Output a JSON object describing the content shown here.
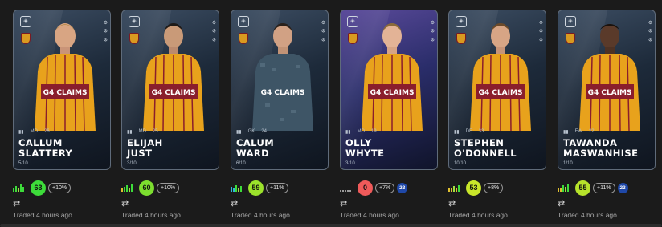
{
  "cards": [
    {
      "name_line1": "CALLUM",
      "name_line2": "SLATTERY",
      "serial": "5/10",
      "stats": [
        "MD",
        "26"
      ],
      "rating": "63",
      "rating_color": "#3ddc3a",
      "change": "+10%",
      "badge": "",
      "traded": "Traded 4 hours ago",
      "kit": "home"
    },
    {
      "name_line1": "ELIJAH",
      "name_line2": "JUST",
      "serial": "3/10",
      "stats": [
        "MD",
        "25"
      ],
      "rating": "60",
      "rating_color": "#7cde2f",
      "change": "+10%",
      "badge": "",
      "traded": "Traded 4 hours ago",
      "kit": "home"
    },
    {
      "name_line1": "CALUM",
      "name_line2": "WARD",
      "serial": "6/10",
      "stats": [
        "GK",
        "24"
      ],
      "rating": "59",
      "rating_color": "#9be22b",
      "change": "+11%",
      "badge": "",
      "traded": "Traded 4 hours ago",
      "kit": "keeper"
    },
    {
      "name_line1": "OLLY",
      "name_line2": "WHYTE",
      "serial": "3/10",
      "stats": [
        "MD",
        "19"
      ],
      "rating": "0",
      "rating_color": "#ef5a5a",
      "change": "+7%",
      "badge": "23",
      "traded": "Traded 4 hours ago",
      "kit": "home"
    },
    {
      "name_line1": "STEPHEN",
      "name_line2": "O'DONNELL",
      "serial": "10/10",
      "stats": [
        "DF",
        "33"
      ],
      "rating": "53",
      "rating_color": "#c9e62a",
      "change": "+8%",
      "badge": "",
      "traded": "Traded 4 hours ago",
      "kit": "home"
    },
    {
      "name_line1": "TAWANDA",
      "name_line2": "MASWANHISE",
      "serial": "1/10",
      "stats": [
        "FW",
        "22"
      ],
      "rating": "55",
      "rating_color": "#b6e32b",
      "change": "+11%",
      "badge": "23",
      "traded": "Traded 4 hours ago",
      "kit": "home"
    }
  ],
  "icons": {
    "league": "spfl-logo-icon",
    "crest": "club-crest-icon",
    "swap": "swap-arrows-icon",
    "bars": "form-bars-icon"
  },
  "colors": {
    "kit_amber": "#e8a21c",
    "kit_claret": "#8a1e2c",
    "keeper": "#3e5566",
    "background": "#1b1b1b"
  }
}
